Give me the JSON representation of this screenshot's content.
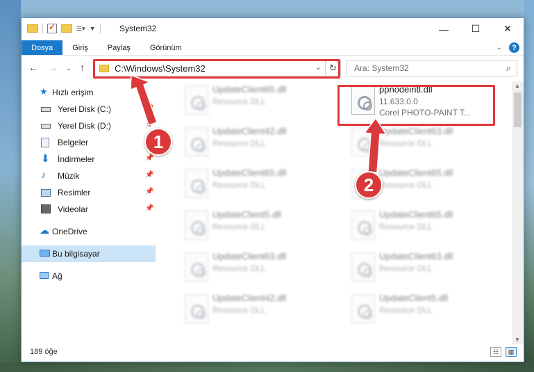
{
  "window": {
    "title": "System32",
    "controls": [
      "—",
      "☐",
      "✕"
    ]
  },
  "ribbon": {
    "tabs": [
      "Dosya",
      "Giriş",
      "Paylaş",
      "Görünüm"
    ],
    "help": "?"
  },
  "nav": {
    "address_path": "C:\\Windows\\System32",
    "search_placeholder": "Ara: System32"
  },
  "sidebar": {
    "quick_access": "Hızlı erişim",
    "items": [
      {
        "label": "Yerel Disk (C:)",
        "icon": "drive-icon",
        "pinned": true
      },
      {
        "label": "Yerel Disk (D:)",
        "icon": "drive-icon",
        "pinned": true
      },
      {
        "label": "Belgeler",
        "icon": "documents-icon",
        "pinned": true
      },
      {
        "label": "İndirmeler",
        "icon": "downloads-icon",
        "pinned": true
      },
      {
        "label": "Müzik",
        "icon": "music-icon",
        "pinned": true
      },
      {
        "label": "Resimler",
        "icon": "pictures-icon",
        "pinned": true
      },
      {
        "label": "Videolar",
        "icon": "videos-icon",
        "pinned": true
      }
    ],
    "onedrive": "OneDrive",
    "this_pc": "Bu bilgisayar",
    "network": "Ağ"
  },
  "files": {
    "highlighted": {
      "name": "ppnodeintl.dll",
      "version": "11.633.0.0",
      "description": "Corel PHOTO-PAINT T..."
    },
    "left_column": [
      {
        "name": "UpdateClient65.dll",
        "type": "Resource DLL"
      },
      {
        "name": "UpdateClient42.dll",
        "type": "Resource DLL"
      },
      {
        "name": "UpdateClient65.dll",
        "type": "Resource DLL"
      },
      {
        "name": "UpdateClient5.dll",
        "type": "Resource DLL"
      },
      {
        "name": "UpdateClient63.dll",
        "type": "Resource DLL"
      },
      {
        "name": "UpdateClient42.dll",
        "type": "Resource DLL"
      }
    ],
    "right_column": [
      {
        "name": "UpdateClient63.dll",
        "type": "Resource DLL"
      },
      {
        "name": "UpdateClient65.dll",
        "type": "Resource DLL"
      },
      {
        "name": "UpdateClient65.dll",
        "type": "Resource DLL"
      },
      {
        "name": "UpdateClient63.dll",
        "type": "Resource DLL"
      },
      {
        "name": "UpdateClient5.dll",
        "type": "Resource DLL"
      }
    ]
  },
  "status": {
    "count": "189 öğe"
  },
  "annotations": {
    "step1": "1",
    "step2": "2",
    "color": "#e0383b"
  }
}
